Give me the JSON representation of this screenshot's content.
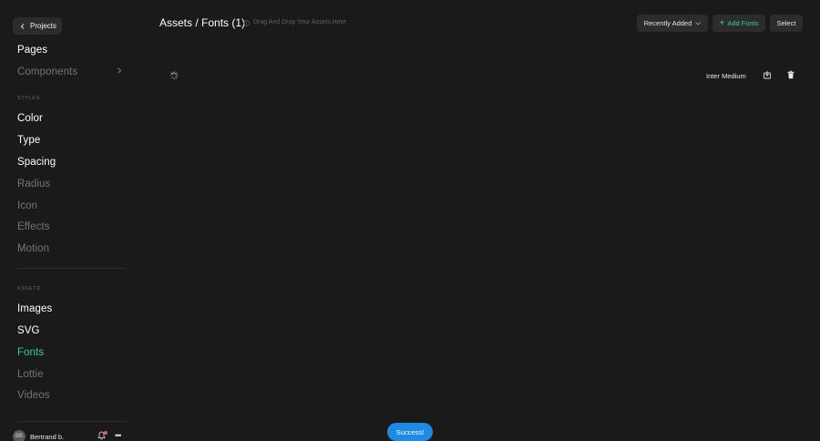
{
  "sidebar": {
    "back_label": "Projects",
    "items_top": [
      {
        "label": "Pages"
      },
      {
        "label": "Components"
      }
    ],
    "styles_label": "STYLES",
    "styles": [
      {
        "label": "Color"
      },
      {
        "label": "Type"
      },
      {
        "label": "Spacing"
      },
      {
        "label": "Radius"
      },
      {
        "label": "Icon"
      },
      {
        "label": "Effects"
      },
      {
        "label": "Motion"
      }
    ],
    "assets_label": "ASSETS",
    "assets": [
      {
        "label": "Images"
      },
      {
        "label": "SVG"
      },
      {
        "label": "Fonts"
      },
      {
        "label": "Lottie"
      },
      {
        "label": "Videos"
      }
    ],
    "user": {
      "initials": "BB",
      "name": "Bertrand b."
    }
  },
  "header": {
    "title": "Assets / Fonts (1)",
    "hint": "Drag And Drop Your Assets Here",
    "sort_label": "Recently Added",
    "add_label": "Add Fonts",
    "select_label": "Select"
  },
  "fonts": [
    {
      "name": "Inter Medium"
    }
  ],
  "toast": {
    "message": "Success!"
  },
  "colors": {
    "background": "#1a1a1a",
    "accent_green": "#2fd48e",
    "toast_blue": "#1f8ae6",
    "muted_text": "#757575"
  }
}
